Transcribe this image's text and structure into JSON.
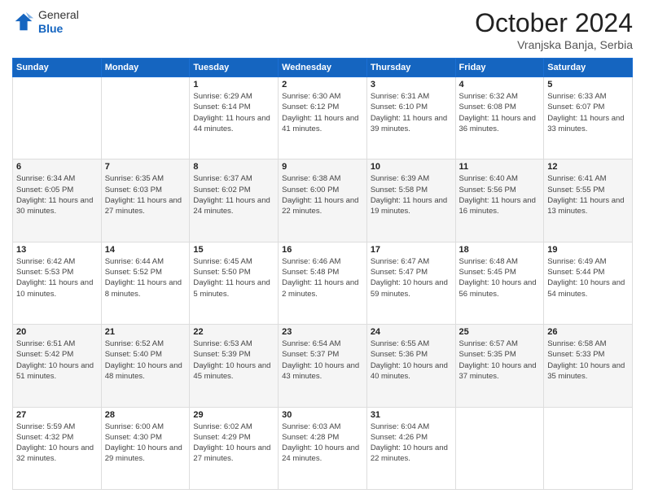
{
  "header": {
    "logo_line1": "General",
    "logo_line2": "Blue",
    "month": "October 2024",
    "location": "Vranjska Banja, Serbia"
  },
  "weekdays": [
    "Sunday",
    "Monday",
    "Tuesday",
    "Wednesday",
    "Thursday",
    "Friday",
    "Saturday"
  ],
  "weeks": [
    [
      {
        "day": "",
        "info": ""
      },
      {
        "day": "",
        "info": ""
      },
      {
        "day": "1",
        "info": "Sunrise: 6:29 AM\nSunset: 6:14 PM\nDaylight: 11 hours and 44 minutes."
      },
      {
        "day": "2",
        "info": "Sunrise: 6:30 AM\nSunset: 6:12 PM\nDaylight: 11 hours and 41 minutes."
      },
      {
        "day": "3",
        "info": "Sunrise: 6:31 AM\nSunset: 6:10 PM\nDaylight: 11 hours and 39 minutes."
      },
      {
        "day": "4",
        "info": "Sunrise: 6:32 AM\nSunset: 6:08 PM\nDaylight: 11 hours and 36 minutes."
      },
      {
        "day": "5",
        "info": "Sunrise: 6:33 AM\nSunset: 6:07 PM\nDaylight: 11 hours and 33 minutes."
      }
    ],
    [
      {
        "day": "6",
        "info": "Sunrise: 6:34 AM\nSunset: 6:05 PM\nDaylight: 11 hours and 30 minutes."
      },
      {
        "day": "7",
        "info": "Sunrise: 6:35 AM\nSunset: 6:03 PM\nDaylight: 11 hours and 27 minutes."
      },
      {
        "day": "8",
        "info": "Sunrise: 6:37 AM\nSunset: 6:02 PM\nDaylight: 11 hours and 24 minutes."
      },
      {
        "day": "9",
        "info": "Sunrise: 6:38 AM\nSunset: 6:00 PM\nDaylight: 11 hours and 22 minutes."
      },
      {
        "day": "10",
        "info": "Sunrise: 6:39 AM\nSunset: 5:58 PM\nDaylight: 11 hours and 19 minutes."
      },
      {
        "day": "11",
        "info": "Sunrise: 6:40 AM\nSunset: 5:56 PM\nDaylight: 11 hours and 16 minutes."
      },
      {
        "day": "12",
        "info": "Sunrise: 6:41 AM\nSunset: 5:55 PM\nDaylight: 11 hours and 13 minutes."
      }
    ],
    [
      {
        "day": "13",
        "info": "Sunrise: 6:42 AM\nSunset: 5:53 PM\nDaylight: 11 hours and 10 minutes."
      },
      {
        "day": "14",
        "info": "Sunrise: 6:44 AM\nSunset: 5:52 PM\nDaylight: 11 hours and 8 minutes."
      },
      {
        "day": "15",
        "info": "Sunrise: 6:45 AM\nSunset: 5:50 PM\nDaylight: 11 hours and 5 minutes."
      },
      {
        "day": "16",
        "info": "Sunrise: 6:46 AM\nSunset: 5:48 PM\nDaylight: 11 hours and 2 minutes."
      },
      {
        "day": "17",
        "info": "Sunrise: 6:47 AM\nSunset: 5:47 PM\nDaylight: 10 hours and 59 minutes."
      },
      {
        "day": "18",
        "info": "Sunrise: 6:48 AM\nSunset: 5:45 PM\nDaylight: 10 hours and 56 minutes."
      },
      {
        "day": "19",
        "info": "Sunrise: 6:49 AM\nSunset: 5:44 PM\nDaylight: 10 hours and 54 minutes."
      }
    ],
    [
      {
        "day": "20",
        "info": "Sunrise: 6:51 AM\nSunset: 5:42 PM\nDaylight: 10 hours and 51 minutes."
      },
      {
        "day": "21",
        "info": "Sunrise: 6:52 AM\nSunset: 5:40 PM\nDaylight: 10 hours and 48 minutes."
      },
      {
        "day": "22",
        "info": "Sunrise: 6:53 AM\nSunset: 5:39 PM\nDaylight: 10 hours and 45 minutes."
      },
      {
        "day": "23",
        "info": "Sunrise: 6:54 AM\nSunset: 5:37 PM\nDaylight: 10 hours and 43 minutes."
      },
      {
        "day": "24",
        "info": "Sunrise: 6:55 AM\nSunset: 5:36 PM\nDaylight: 10 hours and 40 minutes."
      },
      {
        "day": "25",
        "info": "Sunrise: 6:57 AM\nSunset: 5:35 PM\nDaylight: 10 hours and 37 minutes."
      },
      {
        "day": "26",
        "info": "Sunrise: 6:58 AM\nSunset: 5:33 PM\nDaylight: 10 hours and 35 minutes."
      }
    ],
    [
      {
        "day": "27",
        "info": "Sunrise: 5:59 AM\nSunset: 4:32 PM\nDaylight: 10 hours and 32 minutes."
      },
      {
        "day": "28",
        "info": "Sunrise: 6:00 AM\nSunset: 4:30 PM\nDaylight: 10 hours and 29 minutes."
      },
      {
        "day": "29",
        "info": "Sunrise: 6:02 AM\nSunset: 4:29 PM\nDaylight: 10 hours and 27 minutes."
      },
      {
        "day": "30",
        "info": "Sunrise: 6:03 AM\nSunset: 4:28 PM\nDaylight: 10 hours and 24 minutes."
      },
      {
        "day": "31",
        "info": "Sunrise: 6:04 AM\nSunset: 4:26 PM\nDaylight: 10 hours and 22 minutes."
      },
      {
        "day": "",
        "info": ""
      },
      {
        "day": "",
        "info": ""
      }
    ]
  ]
}
